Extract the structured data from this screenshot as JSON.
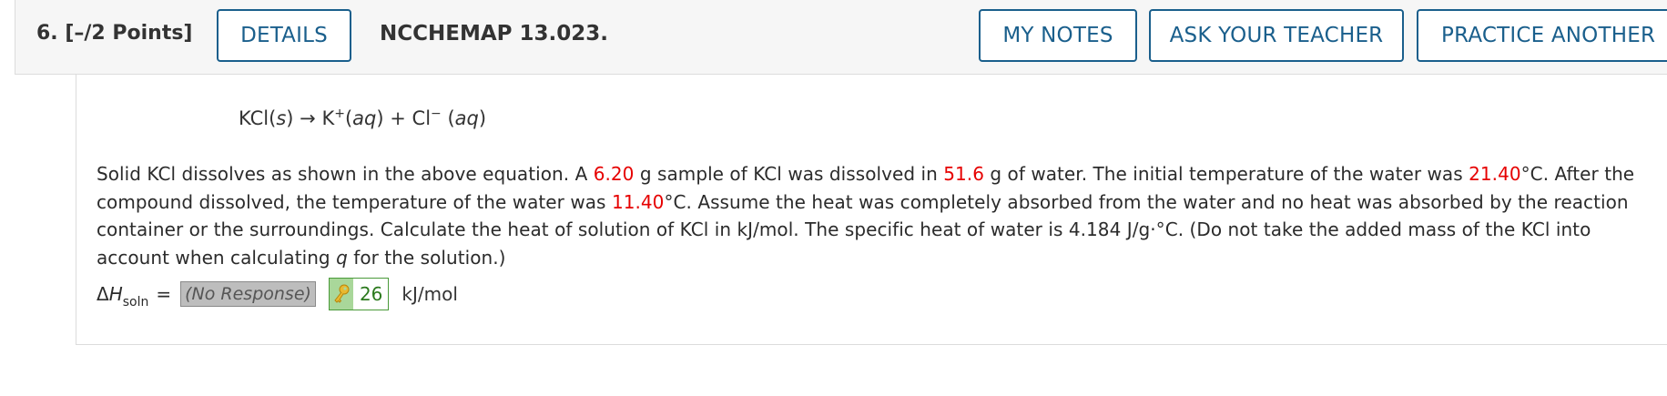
{
  "header": {
    "question_label": "6.  [–/2 Points]",
    "details_label": "DETAILS",
    "assignment_id": "NCCHEMAP 13.023.",
    "my_notes_label": "MY NOTES",
    "ask_teacher_label": "ASK YOUR TEACHER",
    "practice_another_label": "PRACTICE ANOTHER"
  },
  "equation": {
    "reactant": "KCl",
    "reactant_state": "s",
    "arrow": "→",
    "product1": "K",
    "product1_charge": "+",
    "product1_state": "aq",
    "plus": "+",
    "product2": "Cl",
    "product2_charge": "−",
    "product2_state": "aq"
  },
  "problem": {
    "t1": "Solid KCl dissolves as shown in the above equation. A ",
    "mass_kcl": "6.20",
    "t2": " g sample of KCl was dissolved in ",
    "mass_water": "51.6",
    "t3": " g of water. The initial temperature of the water was ",
    "temp_initial": "21.40",
    "t4": "°C. After the compound dissolved, the temperature of the water was ",
    "temp_final": "11.40",
    "t5": "°C. Assume the heat was completely absorbed from the water and no heat was absorbed by the reaction container or the surroundings. Calculate the heat of solution of KCl in kJ/mol. The specific heat of water is 4.184 J/g·°C. (Do not take the added mass of the KCl into account when calculating ",
    "q_var": "q",
    "t6": " for the solution.)"
  },
  "answer": {
    "delta": "Δ",
    "h_var": "H",
    "subscript": "soln",
    "equals": "=",
    "response": "(No Response)",
    "key_icon": "key-icon",
    "key_value": "26",
    "unit": "kJ/mol"
  },
  "colors": {
    "button_border": "#1a5f8c",
    "highlight_red": "#e60000",
    "answer_green": "#2c7a1e"
  }
}
